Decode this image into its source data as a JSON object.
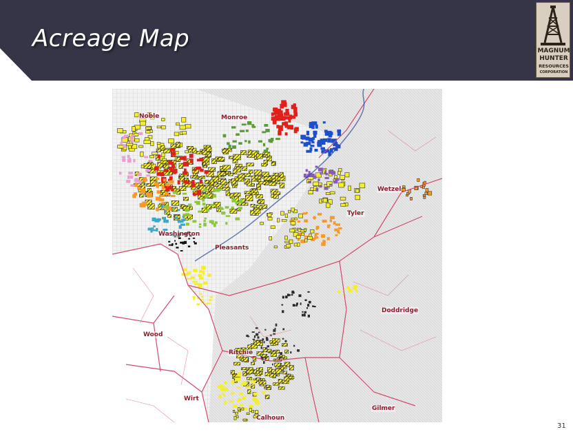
{
  "slide": {
    "title": "Acreage Map",
    "page_number": "31",
    "header_color": "#353547"
  },
  "logo": {
    "lines": [
      "MAGNUM",
      "HUNTER",
      "RESOURCES",
      "CORPORATION"
    ],
    "icon": "oil-derrick-icon"
  },
  "map": {
    "counties": {
      "noble": "Noble",
      "monroe": "Monroe",
      "washington": "Washington",
      "pleasants": "Pleasants",
      "tyler": "Tyler",
      "wetzel": "Wetzel",
      "doddridge": "Doddridge",
      "wood": "Wood",
      "ritchie": "Ritchie",
      "wirt": "Wirt",
      "calhoun": "Calhoun",
      "gilmer": "Gilmer"
    },
    "colors": {
      "county_border": "#d14a6a",
      "acreage_yellow": "#f5ee2a",
      "acreage_red": "#e0201a",
      "acreage_blue": "#1f4fc8",
      "acreage_orange": "#f39a28",
      "acreage_green": "#8cc63f"
    }
  }
}
